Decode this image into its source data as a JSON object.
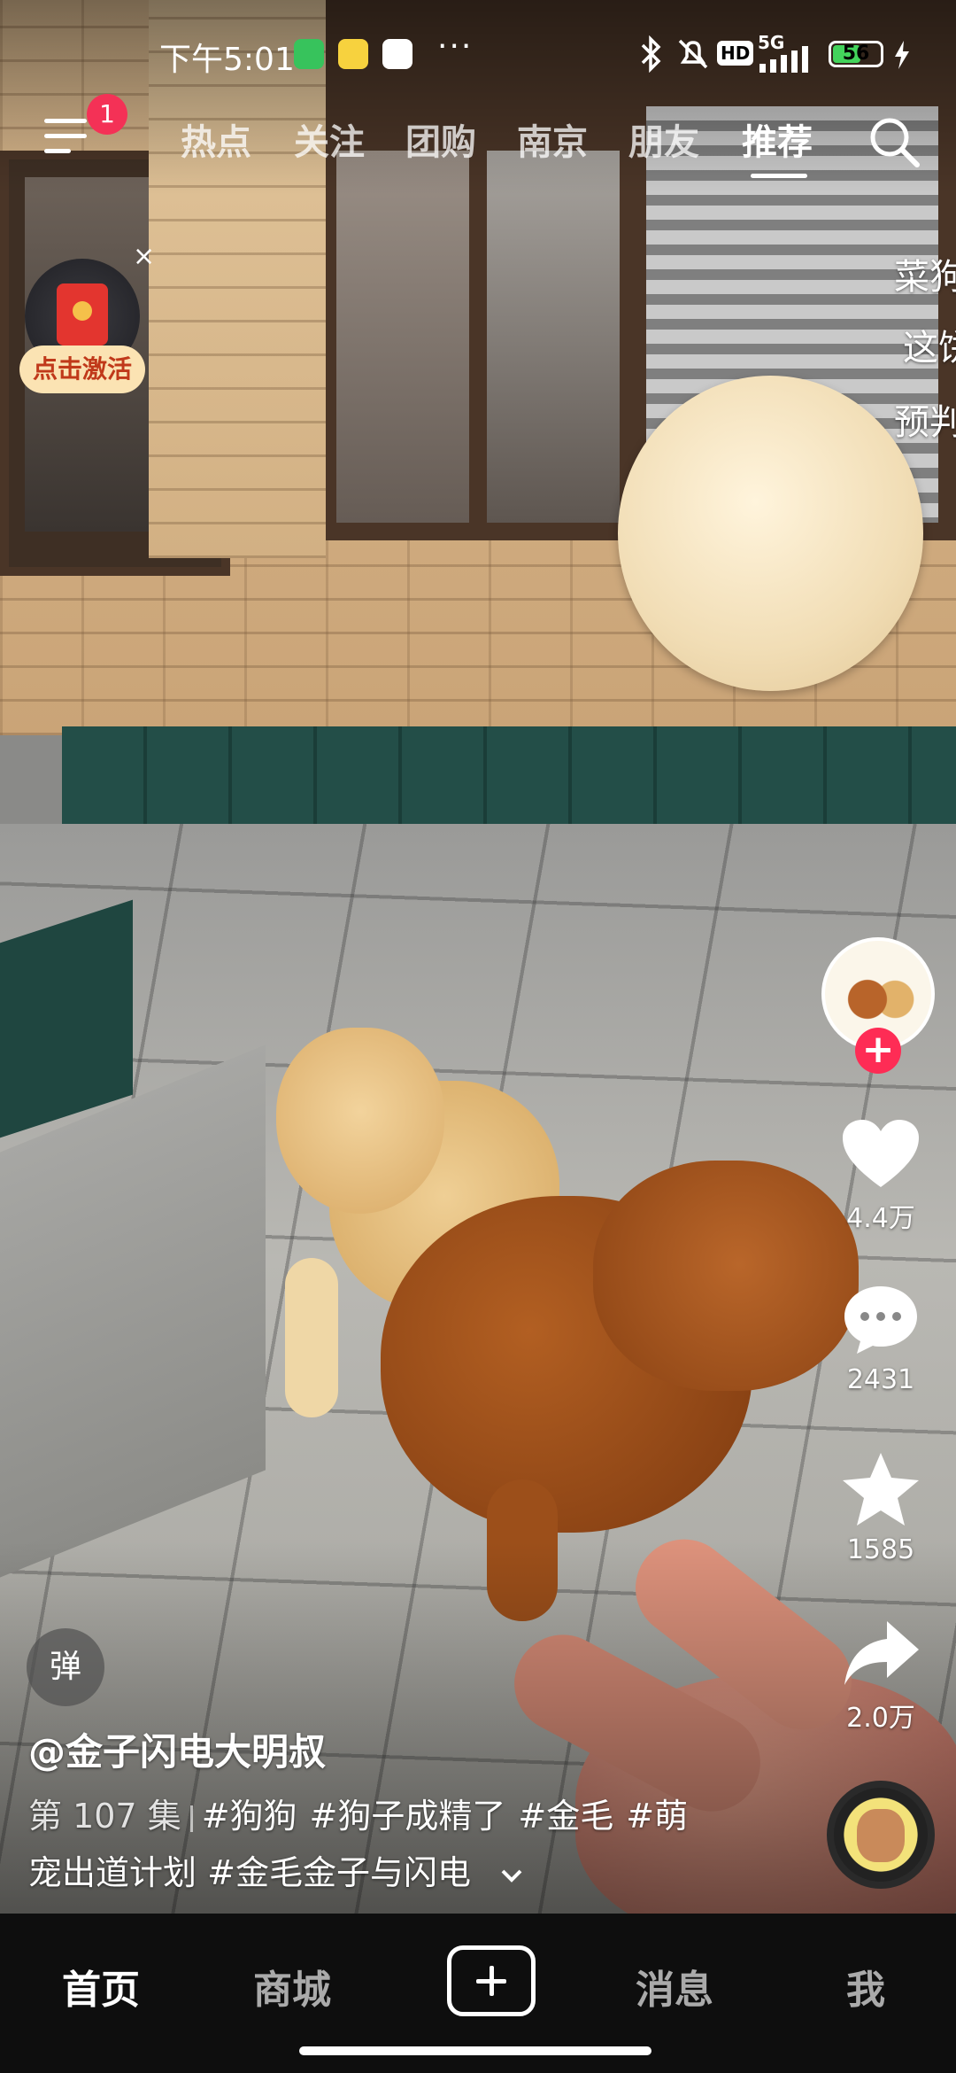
{
  "status_bar": {
    "time": "下午5:01",
    "more": "···",
    "battery": "56",
    "network": "5G",
    "hd": "HD"
  },
  "header": {
    "notification_count": "1",
    "tabs": [
      {
        "label": "热点"
      },
      {
        "label": "关注"
      },
      {
        "label": "团购"
      },
      {
        "label": "南京"
      },
      {
        "label": "朋友"
      },
      {
        "label": "推荐"
      }
    ],
    "active_tab": "推荐"
  },
  "red_packet": {
    "label": "点击激活",
    "close": "×"
  },
  "side_partial_text": [
    "菜狗",
    "这饼",
    "预判"
  ],
  "actions": {
    "likes": "4.4万",
    "comments": "2431",
    "favorites": "1585",
    "shares": "2.0万",
    "follow": "+"
  },
  "video": {
    "danmu_label": "弹",
    "author": "@金子闪电大明叔",
    "episode": "第 107 集",
    "tags_line1": [
      "#狗狗",
      "#狗子成精了",
      "#金毛",
      "#萌"
    ],
    "line2_prefix": "宠出道计划",
    "tags_line2": [
      "#金毛金子与闪电"
    ]
  },
  "bottom_nav": {
    "items": [
      {
        "label": "首页"
      },
      {
        "label": "商城"
      },
      {
        "label": "消息"
      },
      {
        "label": "我"
      }
    ]
  },
  "colors": {
    "accent": "#fe2c55",
    "battery": "#43d35b",
    "nav_bg": "#0e0e0e"
  }
}
